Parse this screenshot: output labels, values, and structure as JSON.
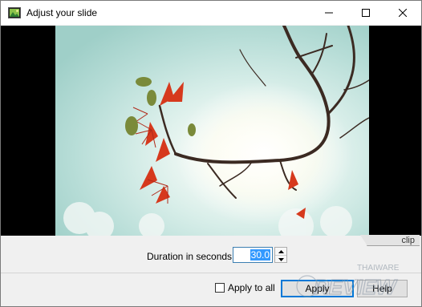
{
  "window": {
    "title": "Adjust your slide",
    "icon": "app-image-icon",
    "controls": [
      "minimize-icon",
      "maximize-icon",
      "close-icon"
    ]
  },
  "preview": {
    "image": "photo of red flowers on bare branches against bright sky",
    "tab_label": "clip"
  },
  "duration": {
    "label": "Duration in seconds:",
    "value": "30.0"
  },
  "footer": {
    "apply_to_all_label": "Apply to all",
    "apply_to_all_checked": false,
    "apply_label": "Apply",
    "help_label": "Help"
  },
  "watermark": {
    "small_text": "THAIWARE",
    "big_text": "REVIEW"
  },
  "colors": {
    "accent": "#0078d7",
    "selection": "#3399ff",
    "dialog_bg": "#f0f0f0"
  }
}
